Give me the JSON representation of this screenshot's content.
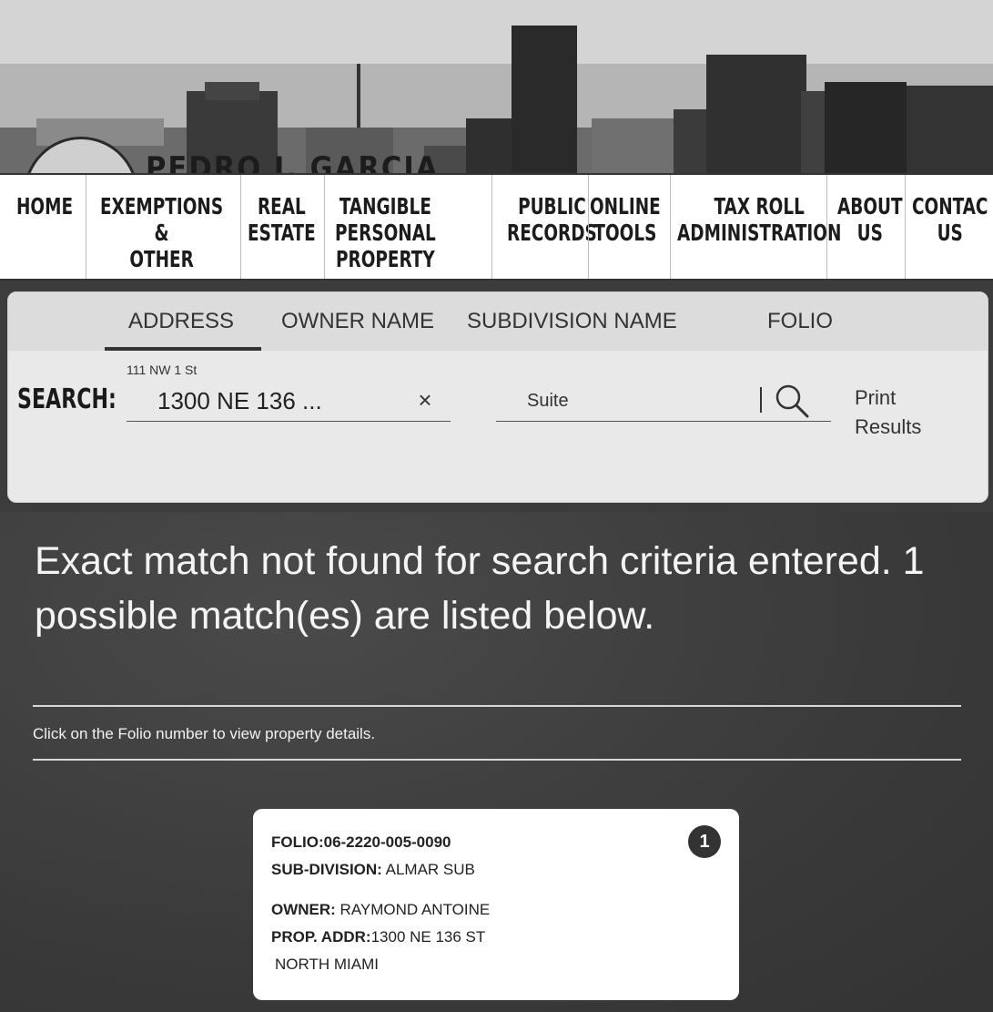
{
  "header": {
    "brand": "PEDRO J. GARCIA"
  },
  "nav": {
    "items": [
      {
        "label": "HOME"
      },
      {
        "label": "EXEMPTIONS\n&\nOTHER"
      },
      {
        "label": "REAL\nESTATE"
      },
      {
        "label": "TANGIBLE\nPERSONAL\nPROPERTY"
      },
      {
        "label": "PUBLIC\nRECORDS"
      },
      {
        "label": "ONLINE\nTOOLS"
      },
      {
        "label": "TAX ROLL\nADMINISTRATION"
      },
      {
        "label": "ABOUT\nUS"
      },
      {
        "label": "CONTAC\nUS"
      }
    ]
  },
  "search": {
    "tabs": [
      "ADDRESS",
      "OWNER NAME",
      "SUBDIVISION NAME",
      "FOLIO"
    ],
    "active_tab": "ADDRESS",
    "label": "SEARCH:",
    "address_hint": "111 NW 1 St",
    "address_value": "1300 NE 136 ...",
    "clear_symbol": "×",
    "suite_placeholder": "Suite",
    "print_label": "Print\nResults"
  },
  "results": {
    "message": "Exact match not found for search criteria entered.   1 possible match(es) are listed below.",
    "hint": "Click on the Folio number to view property details.",
    "items": [
      {
        "index": "1",
        "folio_label": "FOLIO:",
        "folio": "06-2220-005-0090",
        "subdivision_label": "SUB-DIVISION:",
        "subdivision": " ALMAR SUB",
        "owner_label": "OWNER:",
        "owner": " RAYMOND ANTOINE",
        "address_label": "PROP. ADDR:",
        "address": "1300 NE 136 ST",
        "city": "NORTH MIAMI"
      }
    ]
  },
  "colors": {
    "background": "#3c3c3c",
    "card": "#ffffff",
    "search_card": "#e9e9e9",
    "text_light": "#f4f4f4"
  }
}
